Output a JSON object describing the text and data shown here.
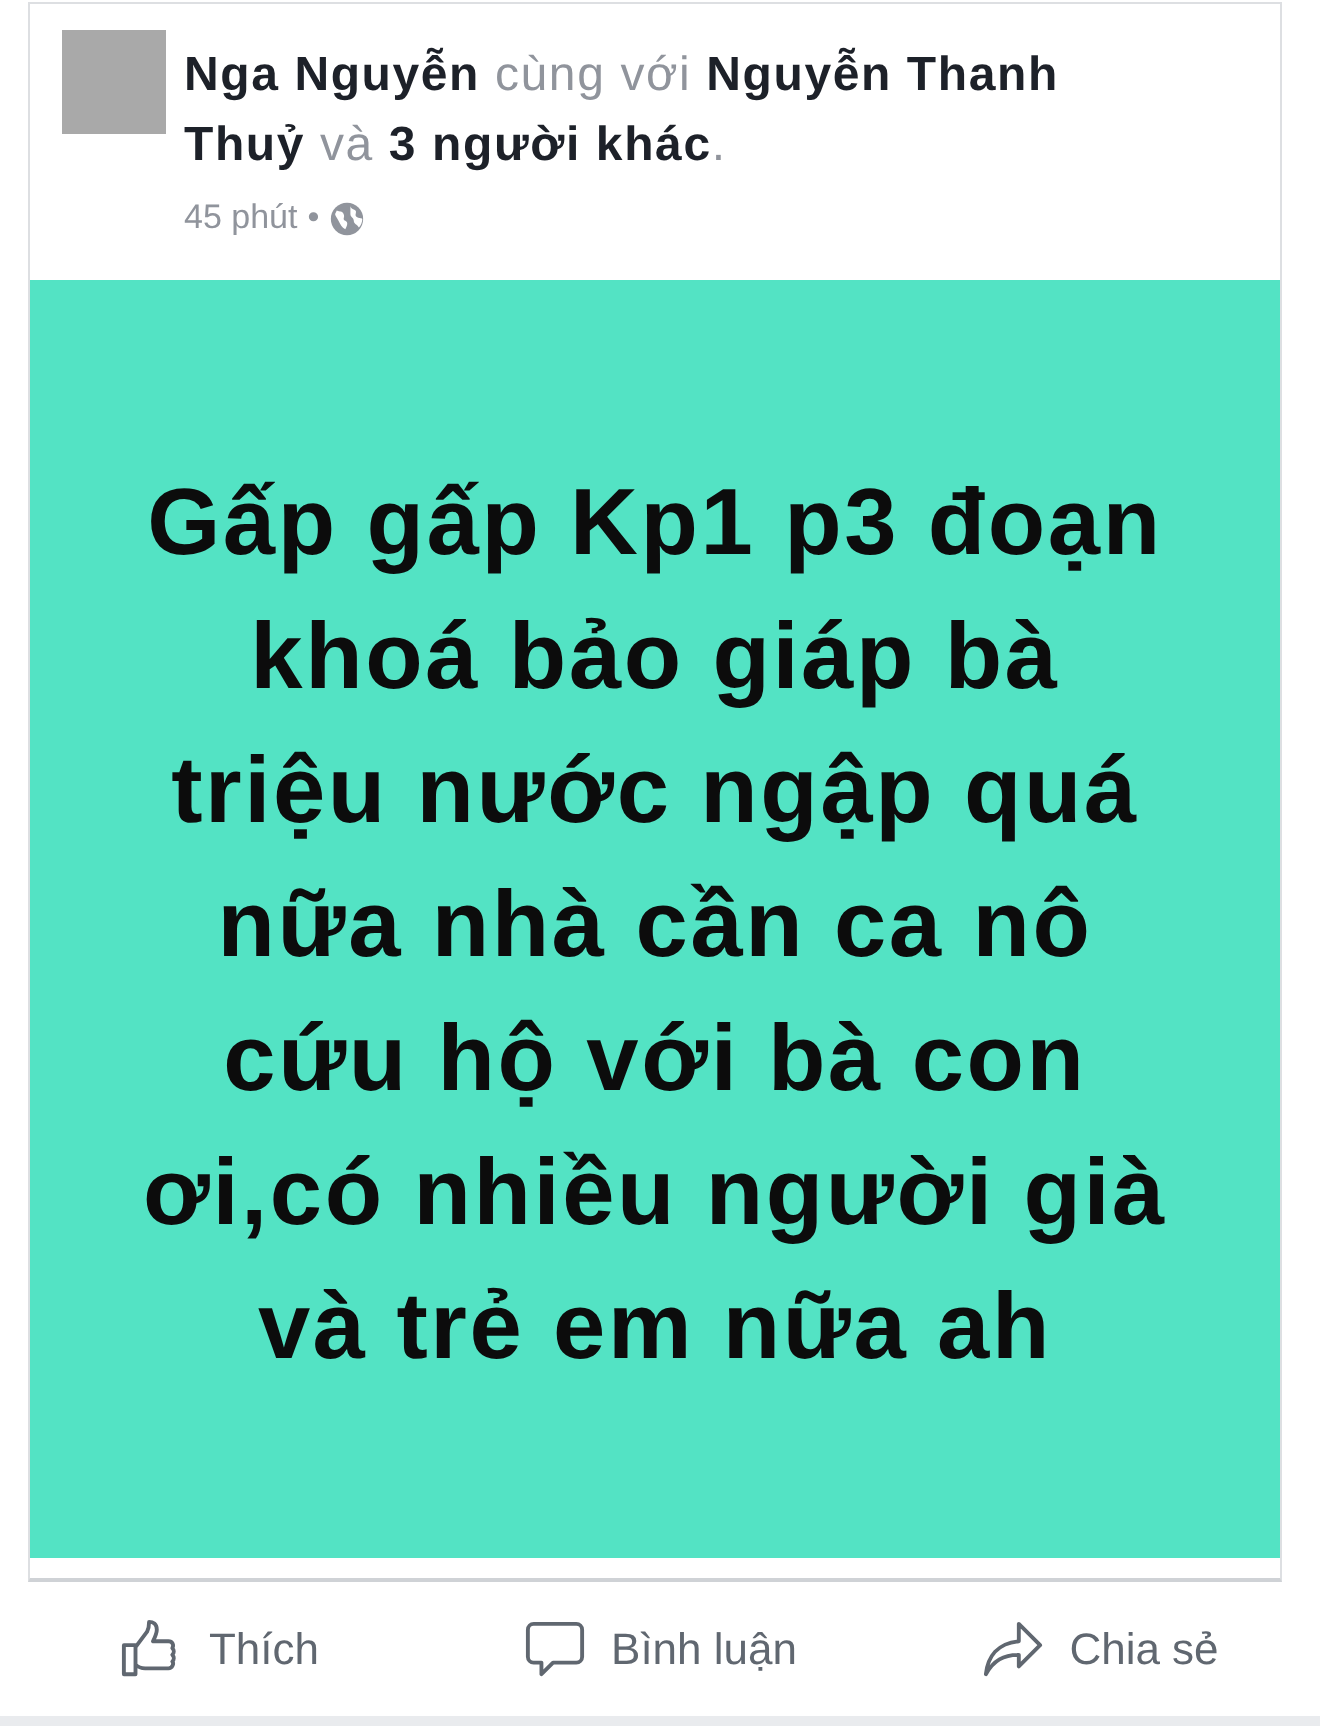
{
  "post": {
    "header": "**Nga Nguyễn** cùng với **Nguyễn Thanh Thuỷ** và **3 người khác**.",
    "time": "45 phút",
    "separator": "•",
    "status_text": "Gấp gấp Kp1 p3 đoạn\nkhoá bảo giáp bà\ntriệu nước ngập quá\nnữa nhà cần ca nô\ncứu hộ với bà con\nơi,có nhiều người già\nvà trẻ em nữa ah"
  },
  "actions": [
    {
      "kind": "like",
      "label": "Thích"
    },
    {
      "kind": "comment",
      "label": "Bình luận"
    },
    {
      "kind": "share",
      "label": "Chia sẻ"
    }
  ]
}
